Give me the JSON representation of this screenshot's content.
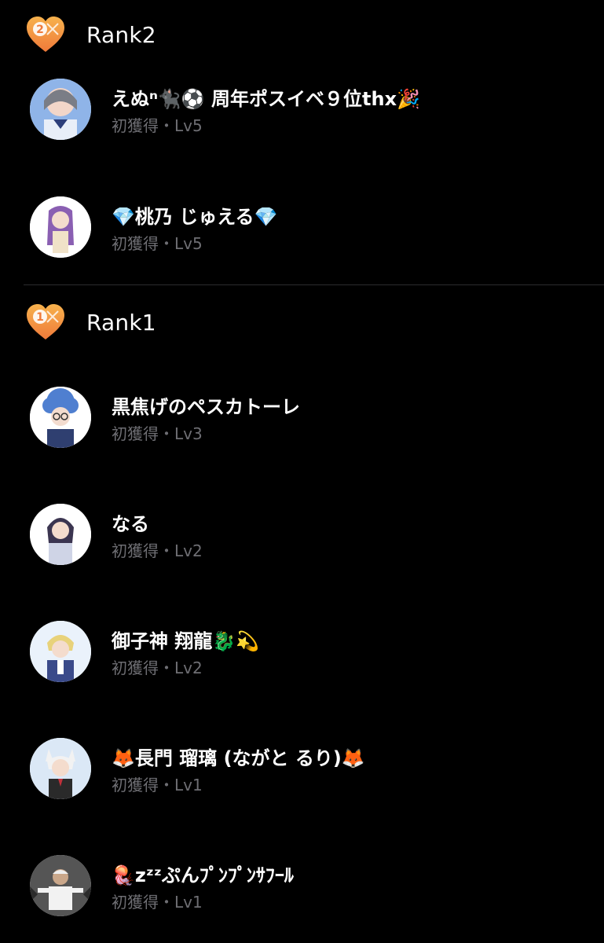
{
  "colors": {
    "background": "#000000",
    "heart_top": "#f7b24d",
    "heart_bottom": "#ef7a3a",
    "text_primary": "#ffffff",
    "text_secondary": "#6e6e73",
    "divider": "#2c2c2e"
  },
  "sections": [
    {
      "rank_badge_number": "2",
      "rank_label": "Rank2",
      "entries": [
        {
          "name": "えぬⁿ🐈‍⬛⚽️ 周年ポスイベ９位thx🎉",
          "meta": "初獲得・Lv5",
          "avatar_icon": "avatar-anime-girl-gray-hair"
        },
        {
          "name": "💎桃乃 じゅえる💎",
          "meta": "初獲得・Lv5",
          "avatar_icon": "avatar-anime-girl-purple-hair"
        }
      ]
    },
    {
      "rank_badge_number": "1",
      "rank_label": "Rank1",
      "entries": [
        {
          "name": "黒焦げのペスカトーレ",
          "meta": "初獲得・Lv3",
          "avatar_icon": "avatar-blue-afro-glasses"
        },
        {
          "name": "なる",
          "meta": "初獲得・Lv2",
          "avatar_icon": "avatar-anime-girl-dark-hair"
        },
        {
          "name": "御子神 翔龍🐉💫",
          "meta": "初獲得・Lv2",
          "avatar_icon": "avatar-anime-boy-blonde"
        },
        {
          "name": "🦊長門 瑠璃 (ながと るり)🦊",
          "meta": "初獲得・Lv1",
          "avatar_icon": "avatar-fox-ears-boy"
        },
        {
          "name": "🪼zᶻᶻぷんﾌﾟﾝﾌﾟﾝｻﾌｰﾙ",
          "meta": "初獲得・Lv1",
          "avatar_icon": "avatar-white-haired-man"
        }
      ]
    }
  ]
}
